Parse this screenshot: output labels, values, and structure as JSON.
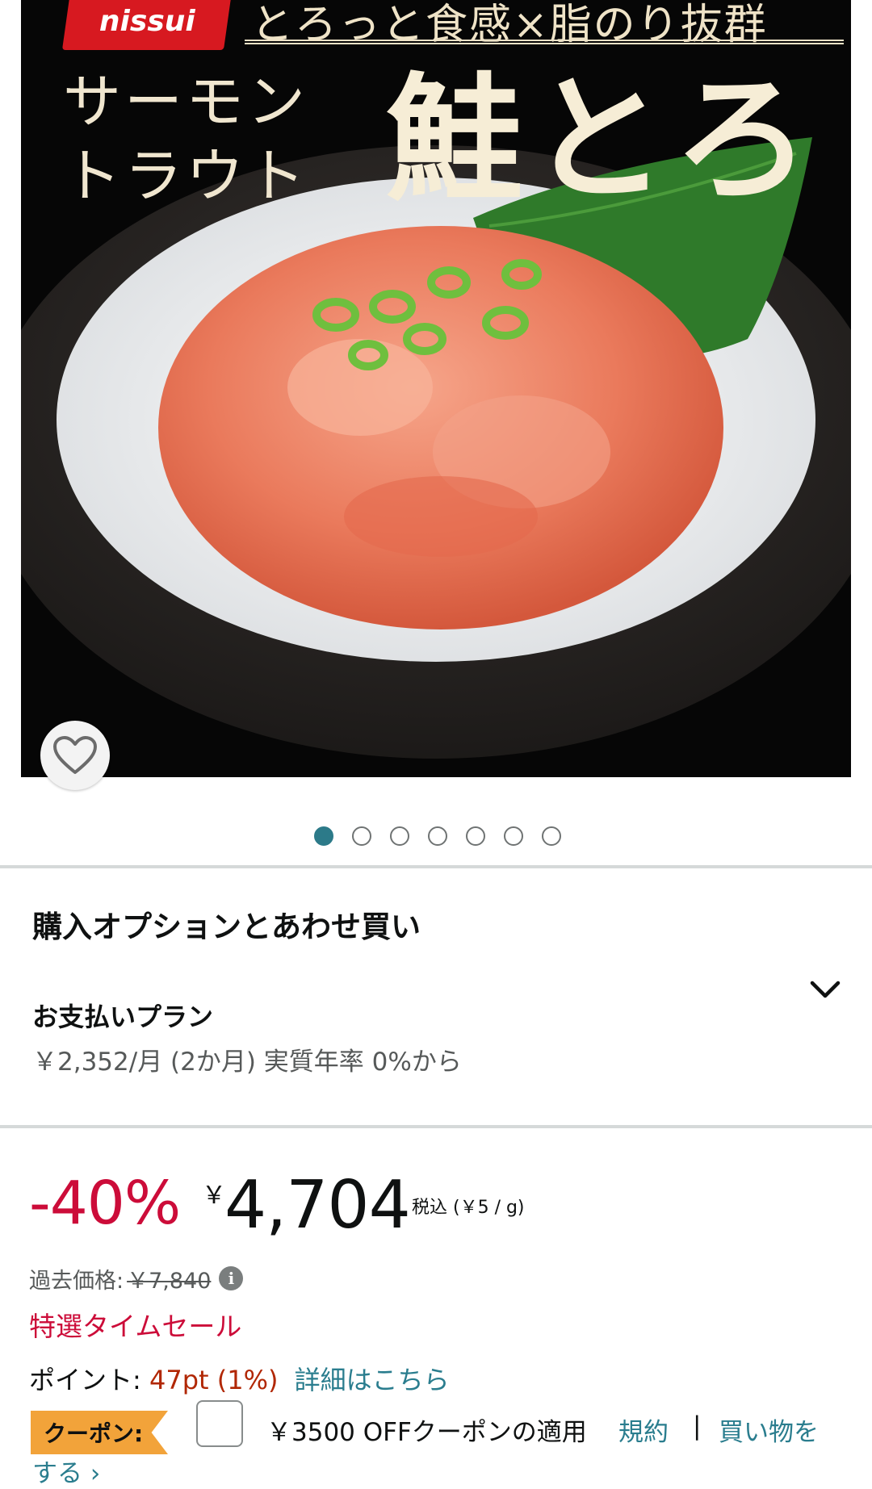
{
  "product_image": {
    "brand": "nissui",
    "tagline": "とろっと食感×脂のり抜群",
    "title_small_line1": "サーモン",
    "title_small_line2": "トラウト",
    "title_big": "鮭とろ",
    "favorite_icon": "heart-outline-icon"
  },
  "carousel": {
    "total": 7,
    "active_index": 0
  },
  "purchase_options": {
    "section_title": "購入オプションとあわせ買い",
    "payment_plan_label": "お支払いプラン",
    "payment_plan_value": "￥2,352/月 (2か月) 実質年率 0%から",
    "expand_icon": "chevron-down-icon"
  },
  "price": {
    "discount": "-40%",
    "currency_symbol": "￥",
    "amount": "4,704",
    "tax_note": "税込 (￥5 / g)",
    "past_price_label": "過去価格:",
    "past_price_value": "￥7,840",
    "info_icon_glyph": "i",
    "deal_label": "特選タイムセール"
  },
  "points": {
    "label": "ポイント: ",
    "value": "47pt",
    "percent": "(1%)",
    "details_link": "詳細はこちら"
  },
  "coupon": {
    "badge": "クーポン:",
    "text": "￥3500 OFFクーポンの適用",
    "terms_link": "規約",
    "separator": "|",
    "shop_link_line1": "買い物を",
    "shop_link_line2": "する ›"
  },
  "colors": {
    "discount_red": "#cc0c39",
    "link_teal": "#2a7d8e",
    "points_orange": "#b12704",
    "coupon_orange": "#f2a33a",
    "active_dot": "#2c7a89"
  }
}
